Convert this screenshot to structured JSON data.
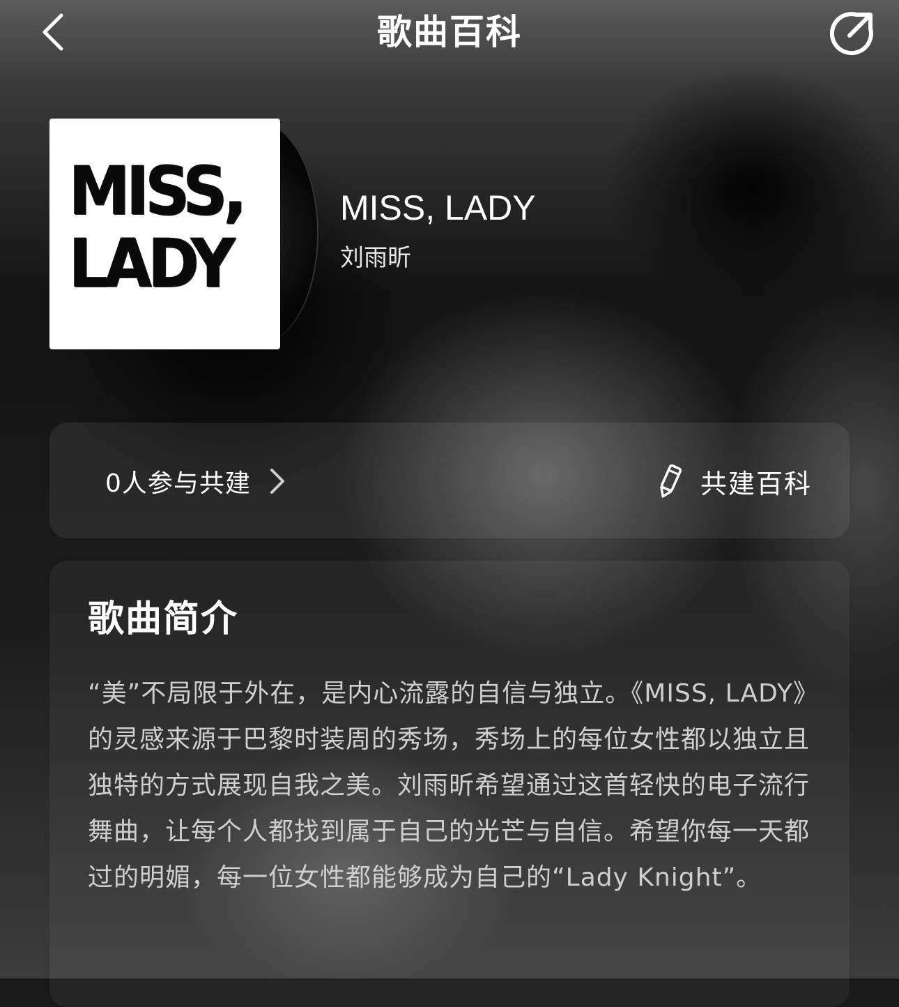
{
  "header": {
    "title": "歌曲百科",
    "back_icon": "chevron-left-icon",
    "share_icon": "share-icon"
  },
  "song": {
    "title": "MISS, LADY",
    "artist": "刘雨昕",
    "cover_text_line1": "MISS,",
    "cover_text_line2": "LADY"
  },
  "contribution": {
    "participants_label": "0人参与共建",
    "build_label": "共建百科"
  },
  "intro": {
    "title": "歌曲简介",
    "body": "“美”不局限于外在，是内心流露的自信与独立。《MISS, LADY》的灵感来源于巴黎时装周的秀场，秀场上的每位女性都以独立且独特的方式展现自我之美。刘雨昕希望通过这首轻快的电子流行舞曲，让每个人都找到属于自己的光芒与自信。希望你每一天都过的明媚，每一位女性都能够成为自己的“Lady Knight”。"
  },
  "colors": {
    "text_primary": "#ffffff",
    "text_secondary": "#cfcfcf"
  }
}
